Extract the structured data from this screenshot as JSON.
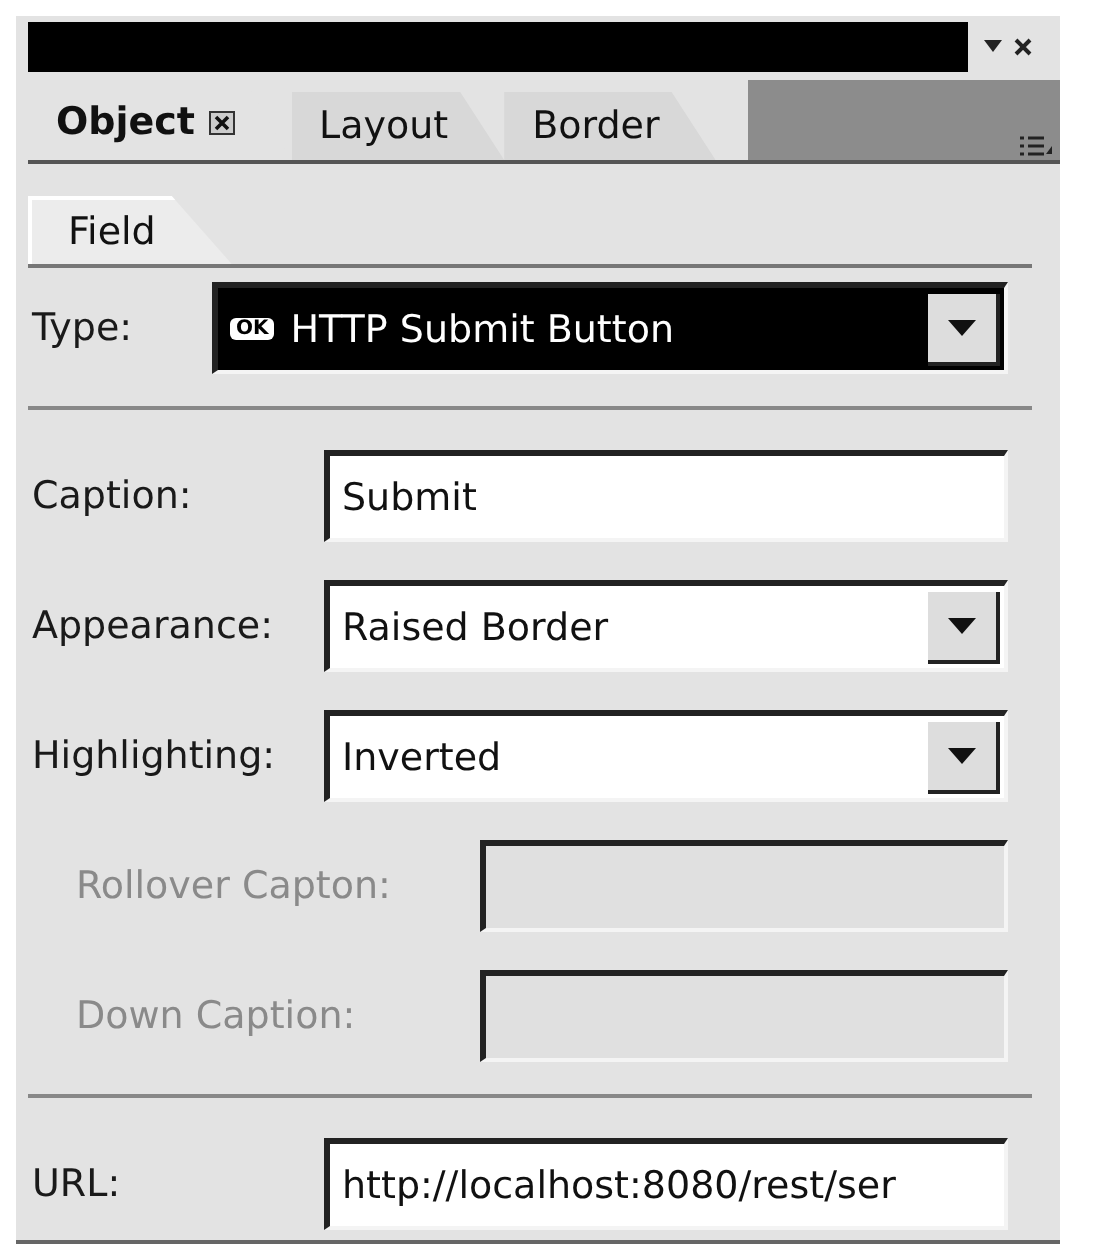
{
  "tabs": [
    {
      "label": "Object",
      "selected": true,
      "closable": true
    },
    {
      "label": "Layout",
      "selected": false,
      "closable": false
    },
    {
      "label": "Border",
      "selected": false,
      "closable": false
    }
  ],
  "subtabs": [
    {
      "label": "Field",
      "selected": true
    }
  ],
  "sections": [
    {
      "fields": [
        {
          "label": "Type:",
          "kind": "dropdown",
          "value": "HTTP Submit Button",
          "badge": "OK",
          "highlighted": true,
          "disabled": false
        }
      ]
    },
    {
      "fields": [
        {
          "label": "Caption:",
          "kind": "text",
          "value": "Submit",
          "highlighted": false,
          "disabled": false
        },
        {
          "label": "Appearance:",
          "kind": "dropdown",
          "value": "Raised Border",
          "highlighted": false,
          "disabled": false
        },
        {
          "label": "Highlighting:",
          "kind": "dropdown",
          "value": "Inverted",
          "highlighted": false,
          "disabled": false
        },
        {
          "label": "Rollover Capton:",
          "kind": "text",
          "highlighted": false,
          "disabled": true
        },
        {
          "label": "Down Caption:",
          "kind": "text",
          "highlighted": false,
          "disabled": true
        }
      ]
    },
    {
      "fields": [
        {
          "label": "URL:",
          "kind": "text",
          "value": "http://localhost:8080/rest/ser",
          "highlighted": false,
          "disabled": false
        }
      ]
    }
  ]
}
